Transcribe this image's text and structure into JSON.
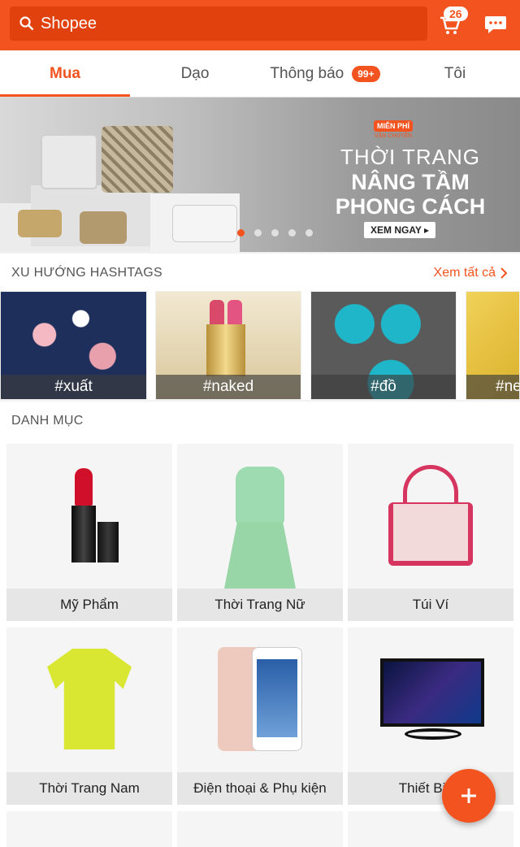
{
  "search": {
    "placeholder": "Shopee"
  },
  "cart": {
    "count": "26"
  },
  "tabs": [
    {
      "label": "Mua"
    },
    {
      "label": "Dạo"
    },
    {
      "label": "Thông báo",
      "badge": "99+"
    },
    {
      "label": "Tôi"
    }
  ],
  "banner": {
    "badge_line1": "MIỄN PHÍ",
    "badge_line2": "VẬN CHUYỂN",
    "line1": "THỜI TRANG",
    "line2": "NÂNG TẦM",
    "line3": "PHONG CÁCH",
    "cta": "XEM NGAY ▸"
  },
  "hashtags": {
    "title": "XU HƯỚNG HASHTAGS",
    "see_all": "Xem tất cả",
    "items": [
      "#xuất",
      "#naked",
      "#đồ",
      "#ne"
    ]
  },
  "categories": {
    "title": "DANH MỤC",
    "items": [
      "Mỹ Phẩm",
      "Thời Trang Nữ",
      "Túi Ví",
      "Thời Trang Nam",
      "Điện thoại & Phụ kiện",
      "Thiết Bị Đi"
    ]
  },
  "colors": {
    "brand": "#f3531f"
  }
}
